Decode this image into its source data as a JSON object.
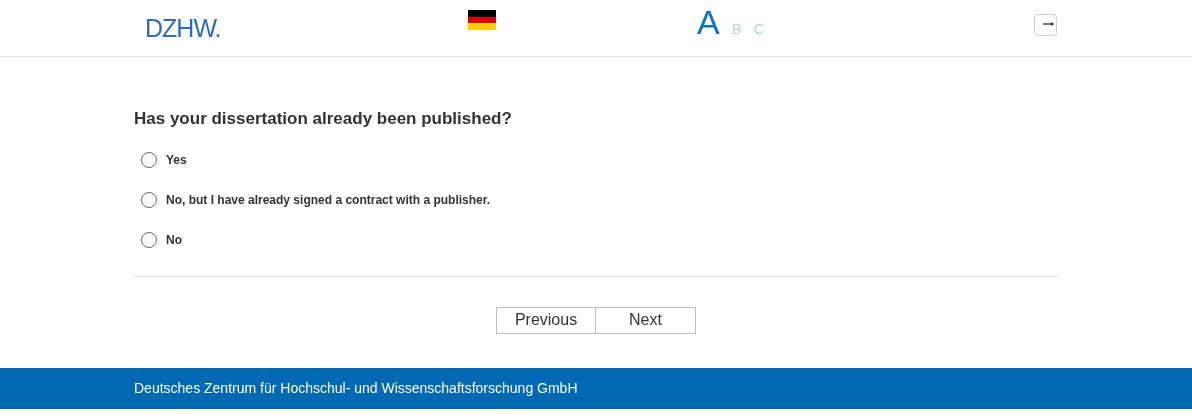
{
  "header": {
    "logo": "DZHW.",
    "font_sizes": [
      {
        "label": "A",
        "selected": true
      },
      {
        "label": "B",
        "selected": false
      },
      {
        "label": "C",
        "selected": false
      }
    ]
  },
  "question": {
    "text": "Has your dissertation already been published?",
    "options": [
      {
        "label": "Yes",
        "selected": false
      },
      {
        "label": "No, but I have already signed a contract with a publisher.",
        "selected": false
      },
      {
        "label": "No",
        "selected": false
      }
    ]
  },
  "buttons": [
    "Previous",
    "Next"
  ],
  "footer": {
    "text": "Deutsches Zentrum für Hochschul- und Wissenschaftsforschung GmbH"
  }
}
